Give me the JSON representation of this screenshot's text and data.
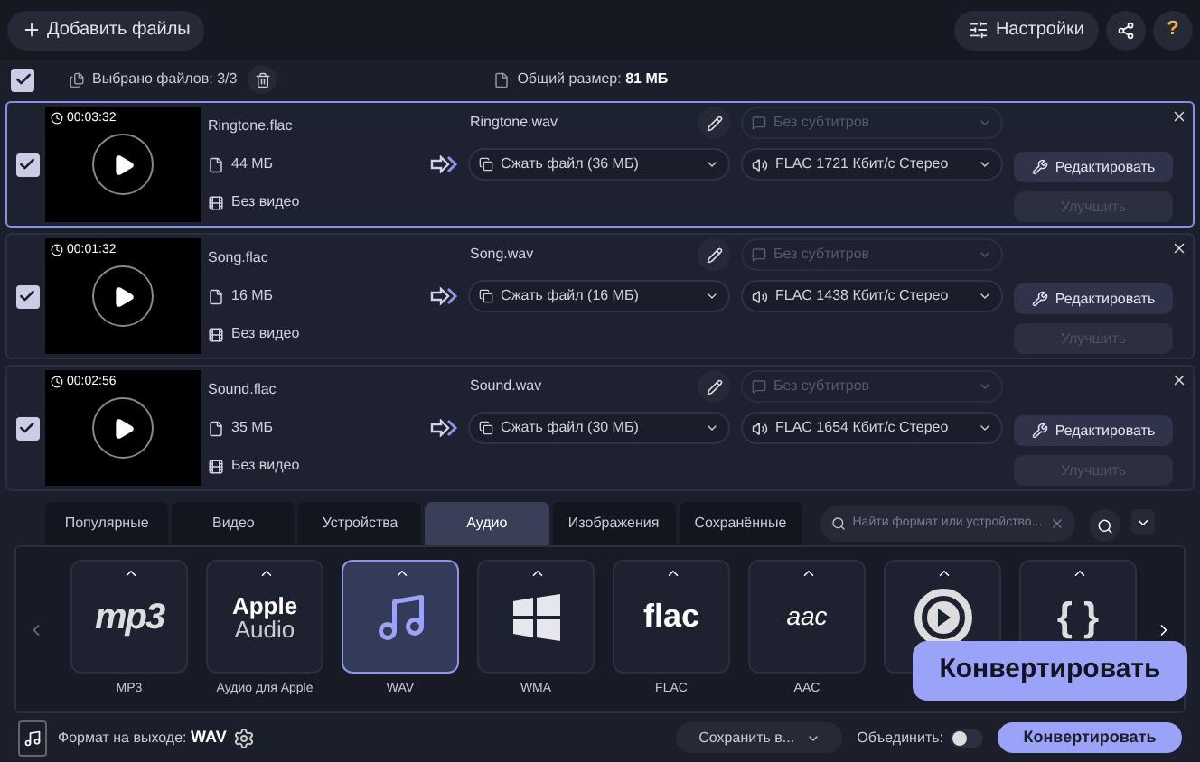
{
  "toolbar": {
    "add_files": "Добавить файлы",
    "settings": "Настройки",
    "help": "?"
  },
  "selection_bar": {
    "checked": true,
    "selected_label": "Выбрано файлов:",
    "selected_count": "3/3",
    "total_label": "Общий размер:",
    "total_size": "81 МБ"
  },
  "files": [
    {
      "checked": true,
      "selected": true,
      "duration": "00:03:32",
      "name": "Ringtone.flac",
      "size": "44 МБ",
      "video": "Без видео",
      "output_name": "Ringtone.wav",
      "subtitles_placeholder": "Без субтитров",
      "compress": "Сжать файл (36 МБ)",
      "audio": "FLAC 1721 Кбит/с Стерео",
      "edit": "Редактировать",
      "enhance": "Улучшить",
      "enhance_disabled": true
    },
    {
      "checked": true,
      "selected": false,
      "duration": "00:01:32",
      "name": "Song.flac",
      "size": "16 МБ",
      "video": "Без видео",
      "output_name": "Song.wav",
      "subtitles_placeholder": "Без субтитров",
      "compress": "Сжать файл (16 МБ)",
      "audio": "FLAC 1438 Кбит/с Стерео",
      "edit": "Редактировать",
      "enhance": "Улучшить",
      "enhance_disabled": true
    },
    {
      "checked": true,
      "selected": false,
      "duration": "00:02:56",
      "name": "Sound.flac",
      "size": "35 МБ",
      "video": "Без видео",
      "output_name": "Sound.wav",
      "subtitles_placeholder": "Без субтитров",
      "compress": "Сжать файл (30 МБ)",
      "audio": "FLAC 1654 Кбит/с Стерео",
      "edit": "Редактировать",
      "enhance": "Улучшить",
      "enhance_disabled": true
    }
  ],
  "format_tabs": [
    {
      "label": "Популярные",
      "selected": false
    },
    {
      "label": "Видео",
      "selected": false
    },
    {
      "label": "Устройства",
      "selected": false
    },
    {
      "label": "Аудио",
      "selected": true
    },
    {
      "label": "Изображения",
      "selected": false
    },
    {
      "label": "Сохранённые",
      "selected": false
    }
  ],
  "format_search": {
    "placeholder": "Найти формат или устройство..."
  },
  "formats": [
    {
      "kind": "mp3",
      "logo": "mp3",
      "label": "MP3",
      "selected": false
    },
    {
      "kind": "apple",
      "logo": "Apple",
      "logo_sub": "Audio",
      "label": "Аудио для Apple",
      "selected": false
    },
    {
      "kind": "note",
      "label": "WAV",
      "selected": true
    },
    {
      "kind": "windows",
      "label": "WMA",
      "selected": false
    },
    {
      "kind": "flac",
      "logo": "flac",
      "label": "FLAC",
      "selected": false
    },
    {
      "kind": "aac",
      "logo": "aac",
      "label": "AAC",
      "selected": false
    },
    {
      "kind": "play",
      "selected": false
    },
    {
      "kind": "braces",
      "logo": "{ }",
      "selected": false
    }
  ],
  "bottom_bar": {
    "output_label": "Формат на выходе:",
    "output_format": "WAV",
    "save_to": "Сохранить в...",
    "merge_label": "Объединить:",
    "merge_on": false,
    "convert": "Конвертировать"
  },
  "tooltip": {
    "text": "Конвертировать"
  }
}
